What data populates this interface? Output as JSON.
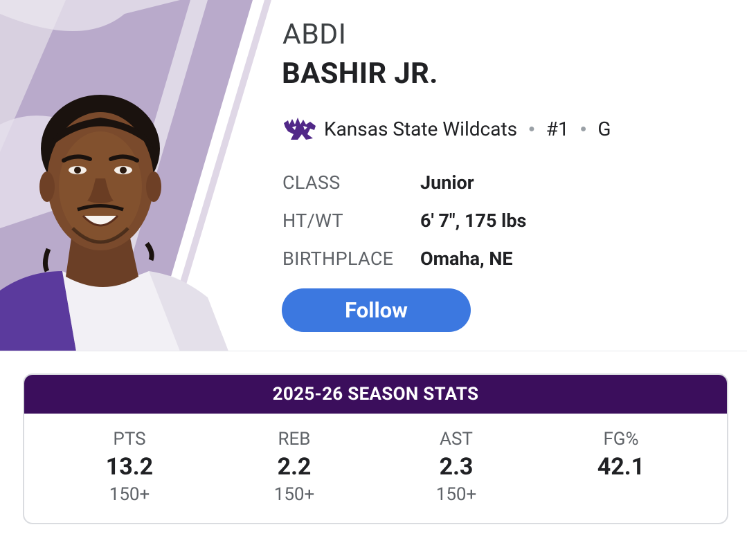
{
  "player": {
    "first_name": "ABDI",
    "last_name": "BASHIR JR.",
    "team": "Kansas State Wildcats",
    "number": "#1",
    "position": "G",
    "team_logo_icon": "kansas-state-powercat-icon",
    "team_color": "#512888"
  },
  "details": [
    {
      "label": "CLASS",
      "value": "Junior"
    },
    {
      "label": "HT/WT",
      "value": "6' 7\", 175 lbs"
    },
    {
      "label": "BIRTHPLACE",
      "value": "Omaha, NE"
    }
  ],
  "follow_button": {
    "label": "Follow",
    "color": "#3c78e0"
  },
  "season_stats": {
    "title": "2025-26 SEASON STATS",
    "header_color": "#3b0e5c",
    "stats": [
      {
        "label": "PTS",
        "value": "13.2",
        "rank": "150+"
      },
      {
        "label": "REB",
        "value": "2.2",
        "rank": "150+"
      },
      {
        "label": "AST",
        "value": "2.3",
        "rank": "150+"
      },
      {
        "label": "FG%",
        "value": "42.1",
        "rank": ""
      }
    ]
  }
}
